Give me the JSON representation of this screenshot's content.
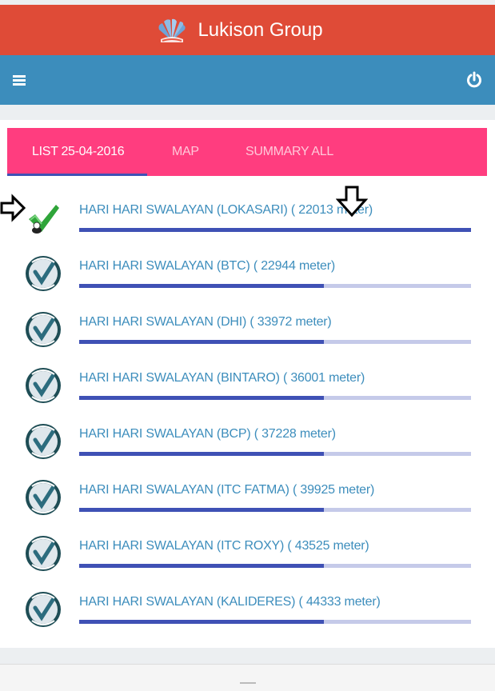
{
  "header": {
    "brand_title": "Lukison Group",
    "logo_icon": "lukison-logo-icon",
    "color": "#df4b37"
  },
  "navbar": {
    "menu_icon": "hamburger-menu-icon",
    "power_icon": "power-icon",
    "color": "#3c8dbc"
  },
  "tabs": [
    {
      "label": "LIST 25-04-2016",
      "active": true
    },
    {
      "label": "MAP",
      "active": false
    },
    {
      "label": "SUMMARY ALL",
      "active": false
    }
  ],
  "stores": [
    {
      "label": "HARI HARI SWALAYAN (LOKASARI) ( 22013 meter)",
      "icon": "checkmark-icon",
      "progress": 1.0
    },
    {
      "label": "HARI HARI SWALAYAN (BTC) ( 22944 meter)",
      "icon": "customer-promise-badge-icon",
      "progress": 0.625
    },
    {
      "label": "HARI HARI SWALAYAN (DHI) ( 33972 meter)",
      "icon": "customer-promise-badge-icon",
      "progress": 0.625
    },
    {
      "label": "HARI HARI SWALAYAN (BINTARO) ( 36001 meter)",
      "icon": "customer-promise-badge-icon",
      "progress": 0.625
    },
    {
      "label": "HARI HARI SWALAYAN (BCP) ( 37228 meter)",
      "icon": "customer-promise-badge-icon",
      "progress": 0.625
    },
    {
      "label": "HARI HARI SWALAYAN (ITC FATMA) ( 39925 meter)",
      "icon": "customer-promise-badge-icon",
      "progress": 0.625
    },
    {
      "label": "HARI HARI SWALAYAN (ITC ROXY) ( 43525 meter)",
      "icon": "customer-promise-badge-icon",
      "progress": 0.625
    },
    {
      "label": "HARI HARI SWALAYAN (KALIDERES) ( 44333 meter)",
      "icon": "customer-promise-badge-icon",
      "progress": 0.625
    }
  ],
  "colors": {
    "tab_bar": "#ff3d7f",
    "link_text": "#3c8dbc",
    "progress_fill": "#3f51b5",
    "progress_track": "#c5cae9"
  }
}
